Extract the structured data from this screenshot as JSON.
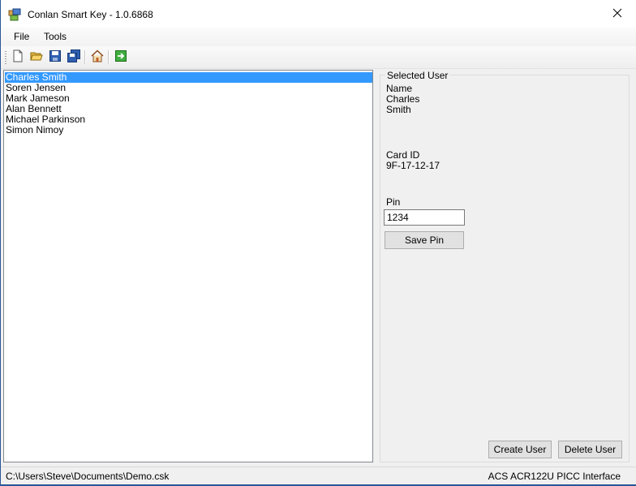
{
  "window": {
    "title": "Conlan Smart Key - 1.0.6868",
    "app_icon": "app-window-icon",
    "close_icon": "close-icon"
  },
  "menu": {
    "items": [
      {
        "label": "File"
      },
      {
        "label": "Tools"
      }
    ]
  },
  "toolbar": {
    "buttons": [
      {
        "icon": "new-file-icon"
      },
      {
        "icon": "open-folder-icon"
      },
      {
        "icon": "save-icon"
      },
      {
        "icon": "save-all-icon"
      },
      {
        "icon": "home-icon"
      },
      {
        "icon": "exit-arrow-icon"
      }
    ]
  },
  "users": {
    "items": [
      {
        "label": "Charles Smith",
        "selected": true
      },
      {
        "label": "Soren Jensen"
      },
      {
        "label": "Mark Jameson"
      },
      {
        "label": "Alan Bennett"
      },
      {
        "label": "Michael Parkinson"
      },
      {
        "label": "Simon Nimoy"
      }
    ]
  },
  "selected_user": {
    "legend": "Selected User",
    "name_label": "Name",
    "first_name": "Charles",
    "last_name": "Smith",
    "card_id_label": "Card ID",
    "card_id": "9F-17-12-17",
    "pin_label": "Pin",
    "pin_value": "1234",
    "save_pin_label": "Save Pin"
  },
  "actions": {
    "create_user_label": "Create User",
    "delete_user_label": "Delete User"
  },
  "status": {
    "file_path": "C:\\Users\\Steve\\Documents\\Demo.csk",
    "reader": "ACS ACR122U PICC Interface"
  },
  "colors": {
    "selection": "#3399ff",
    "window_border": "#2b5797"
  }
}
